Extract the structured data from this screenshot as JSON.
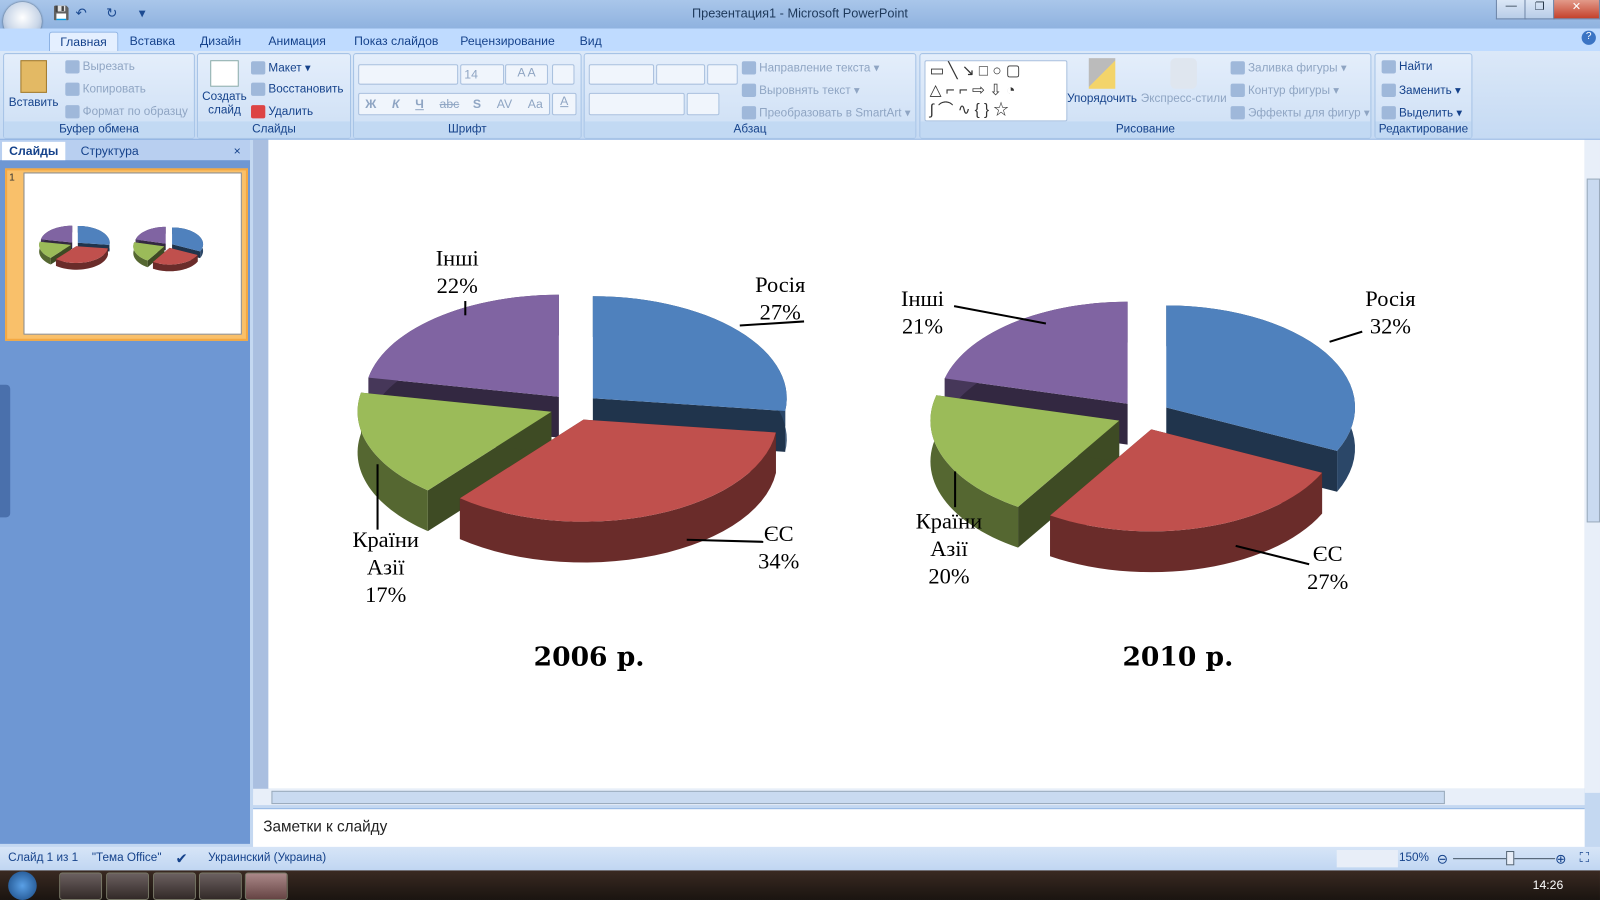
{
  "window": {
    "title": "Презентация1 - Microsoft PowerPoint",
    "min": "—",
    "restore": "❐",
    "close": "✕"
  },
  "tabs": [
    "Главная",
    "Вставка",
    "Дизайн",
    "Анимация",
    "Показ слайдов",
    "Рецензирование",
    "Вид"
  ],
  "ribbon": {
    "clipboard": {
      "label": "Буфер обмена",
      "paste": "Вставить",
      "cut": "Вырезать",
      "copy": "Копировать",
      "format": "Формат по образцу"
    },
    "slides": {
      "label": "Слайды",
      "new": "Создать слайд",
      "layout": "Макет",
      "reset": "Восстановить",
      "delete": "Удалить"
    },
    "font": {
      "label": "Шрифт",
      "size": "14",
      "bold": "Ж",
      "italic": "К",
      "underline": "Ч",
      "strike": "abc",
      "shadow": "S",
      "spacing": "AV",
      "case": "Aa",
      "color": "A"
    },
    "paragraph": {
      "label": "Абзац",
      "direction": "Направление текста",
      "align": "Выровнять текст",
      "smartart": "Преобразовать в SmartArt"
    },
    "drawing": {
      "label": "Рисование",
      "arrange": "Упорядочить",
      "styles": "Экспресс-стили",
      "fill": "Заливка фигуры",
      "outline": "Контур фигуры",
      "effects": "Эффекты для фигур"
    },
    "editing": {
      "label": "Редактирование",
      "find": "Найти",
      "replace": "Заменить",
      "select": "Выделить"
    }
  },
  "pane": {
    "tab_slides": "Слайды",
    "tab_outline": "Структура",
    "close": "×",
    "slide_number": "1"
  },
  "notes": {
    "placeholder": "Заметки к слайду"
  },
  "status": {
    "slide": "Слайд 1 из 1",
    "theme": "\"Тема Office\"",
    "language": "Украинский (Украина)",
    "zoom": "150%"
  },
  "taskbar": {
    "time": "14:26"
  },
  "chart_data": [
    {
      "type": "pie",
      "title": "2006 р.",
      "categories": [
        "Росія",
        "ЄС",
        "Країни Азії",
        "Інші"
      ],
      "values": [
        27,
        34,
        17,
        22
      ],
      "labels": [
        "27%",
        "34%",
        "17%",
        "22%"
      ],
      "colors": [
        "#4f81bd",
        "#c0504d",
        "#9bbb59",
        "#8064a2"
      ]
    },
    {
      "type": "pie",
      "title": "2010 р.",
      "categories": [
        "Росія",
        "ЄС",
        "Країни Азії",
        "Інші"
      ],
      "values": [
        32,
        27,
        20,
        21
      ],
      "labels": [
        "32%",
        "27%",
        "20%",
        "21%"
      ],
      "colors": [
        "#4f81bd",
        "#c0504d",
        "#9bbb59",
        "#8064a2"
      ]
    }
  ]
}
